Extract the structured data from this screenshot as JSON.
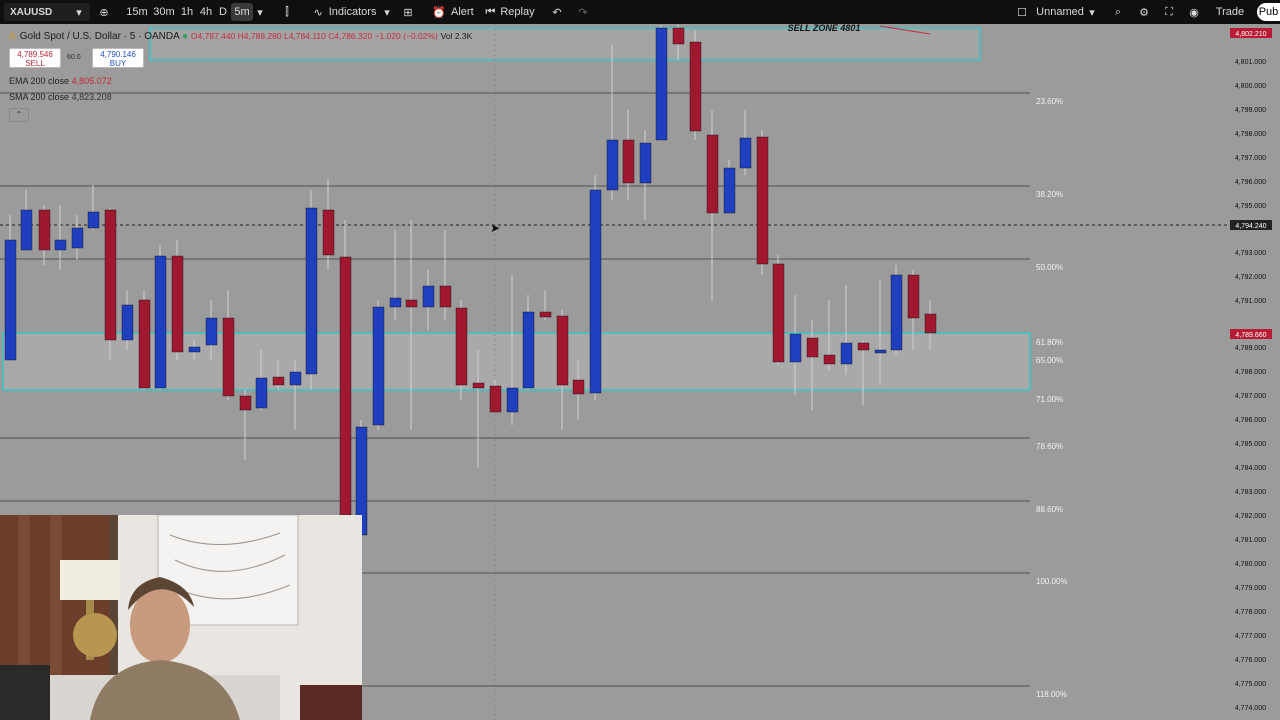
{
  "toolbar": {
    "symbol": "XAUUSD",
    "intervals": [
      "15m",
      "30m",
      "1h",
      "4h",
      "D",
      "5m"
    ],
    "active_interval": "5m",
    "indicators": "Indicators",
    "alert": "Alert",
    "replay": "Replay",
    "layout_name": "Unnamed",
    "trade": "Trade",
    "publish": "Pub"
  },
  "legend": {
    "title": "Gold Spot / U.S. Dollar · 5 · OANDA",
    "ohlc": "O4,787.440  H4,788.280  L4,784.110  C4,786.320  −1.020 (−0.02%)",
    "vol": "Vol 2.3K",
    "sell_price": "4,789.546",
    "sell_label": "SELL",
    "spread": "60.0",
    "buy_price": "4,790.146",
    "buy_label": "BUY"
  },
  "indicators": [
    {
      "name": "EMA 200 close",
      "value": "4,805.072"
    },
    {
      "name": "SMA 200 close",
      "value": "4,823.208"
    }
  ],
  "annotation": "SELL ZONE 4801",
  "fib_levels": [
    "23.60%",
    "38.20%",
    "50.00%",
    "61.80%",
    "65.00%",
    "71.00%",
    "78.60%",
    "88.60%",
    "100.00%",
    "118.00%"
  ],
  "price_axis": [
    "4,801.000",
    "4,800.000",
    "4,799.000",
    "4,798.000",
    "4,797.000",
    "4,796.000",
    "4,795.000",
    "4,793.000",
    "4,792.000",
    "4,791.000",
    "4,789.000",
    "4,788.000",
    "4,787.000",
    "4,786.000",
    "4,785.000",
    "4,784.000",
    "4,783.000",
    "4,782.000",
    "4,781.000",
    "4,780.000",
    "4,779.000",
    "4,778.000",
    "4,777.000",
    "4,776.000",
    "4,775.000",
    "4,774.000"
  ],
  "price_tags": {
    "top": "4,802.210",
    "crosshair": "4,794.240",
    "current": "4,789.660"
  },
  "colors": {
    "bull": "#1f3fbf",
    "bear": "#a01830",
    "zone": "#37c6c6",
    "background": "#9b9b9b"
  }
}
